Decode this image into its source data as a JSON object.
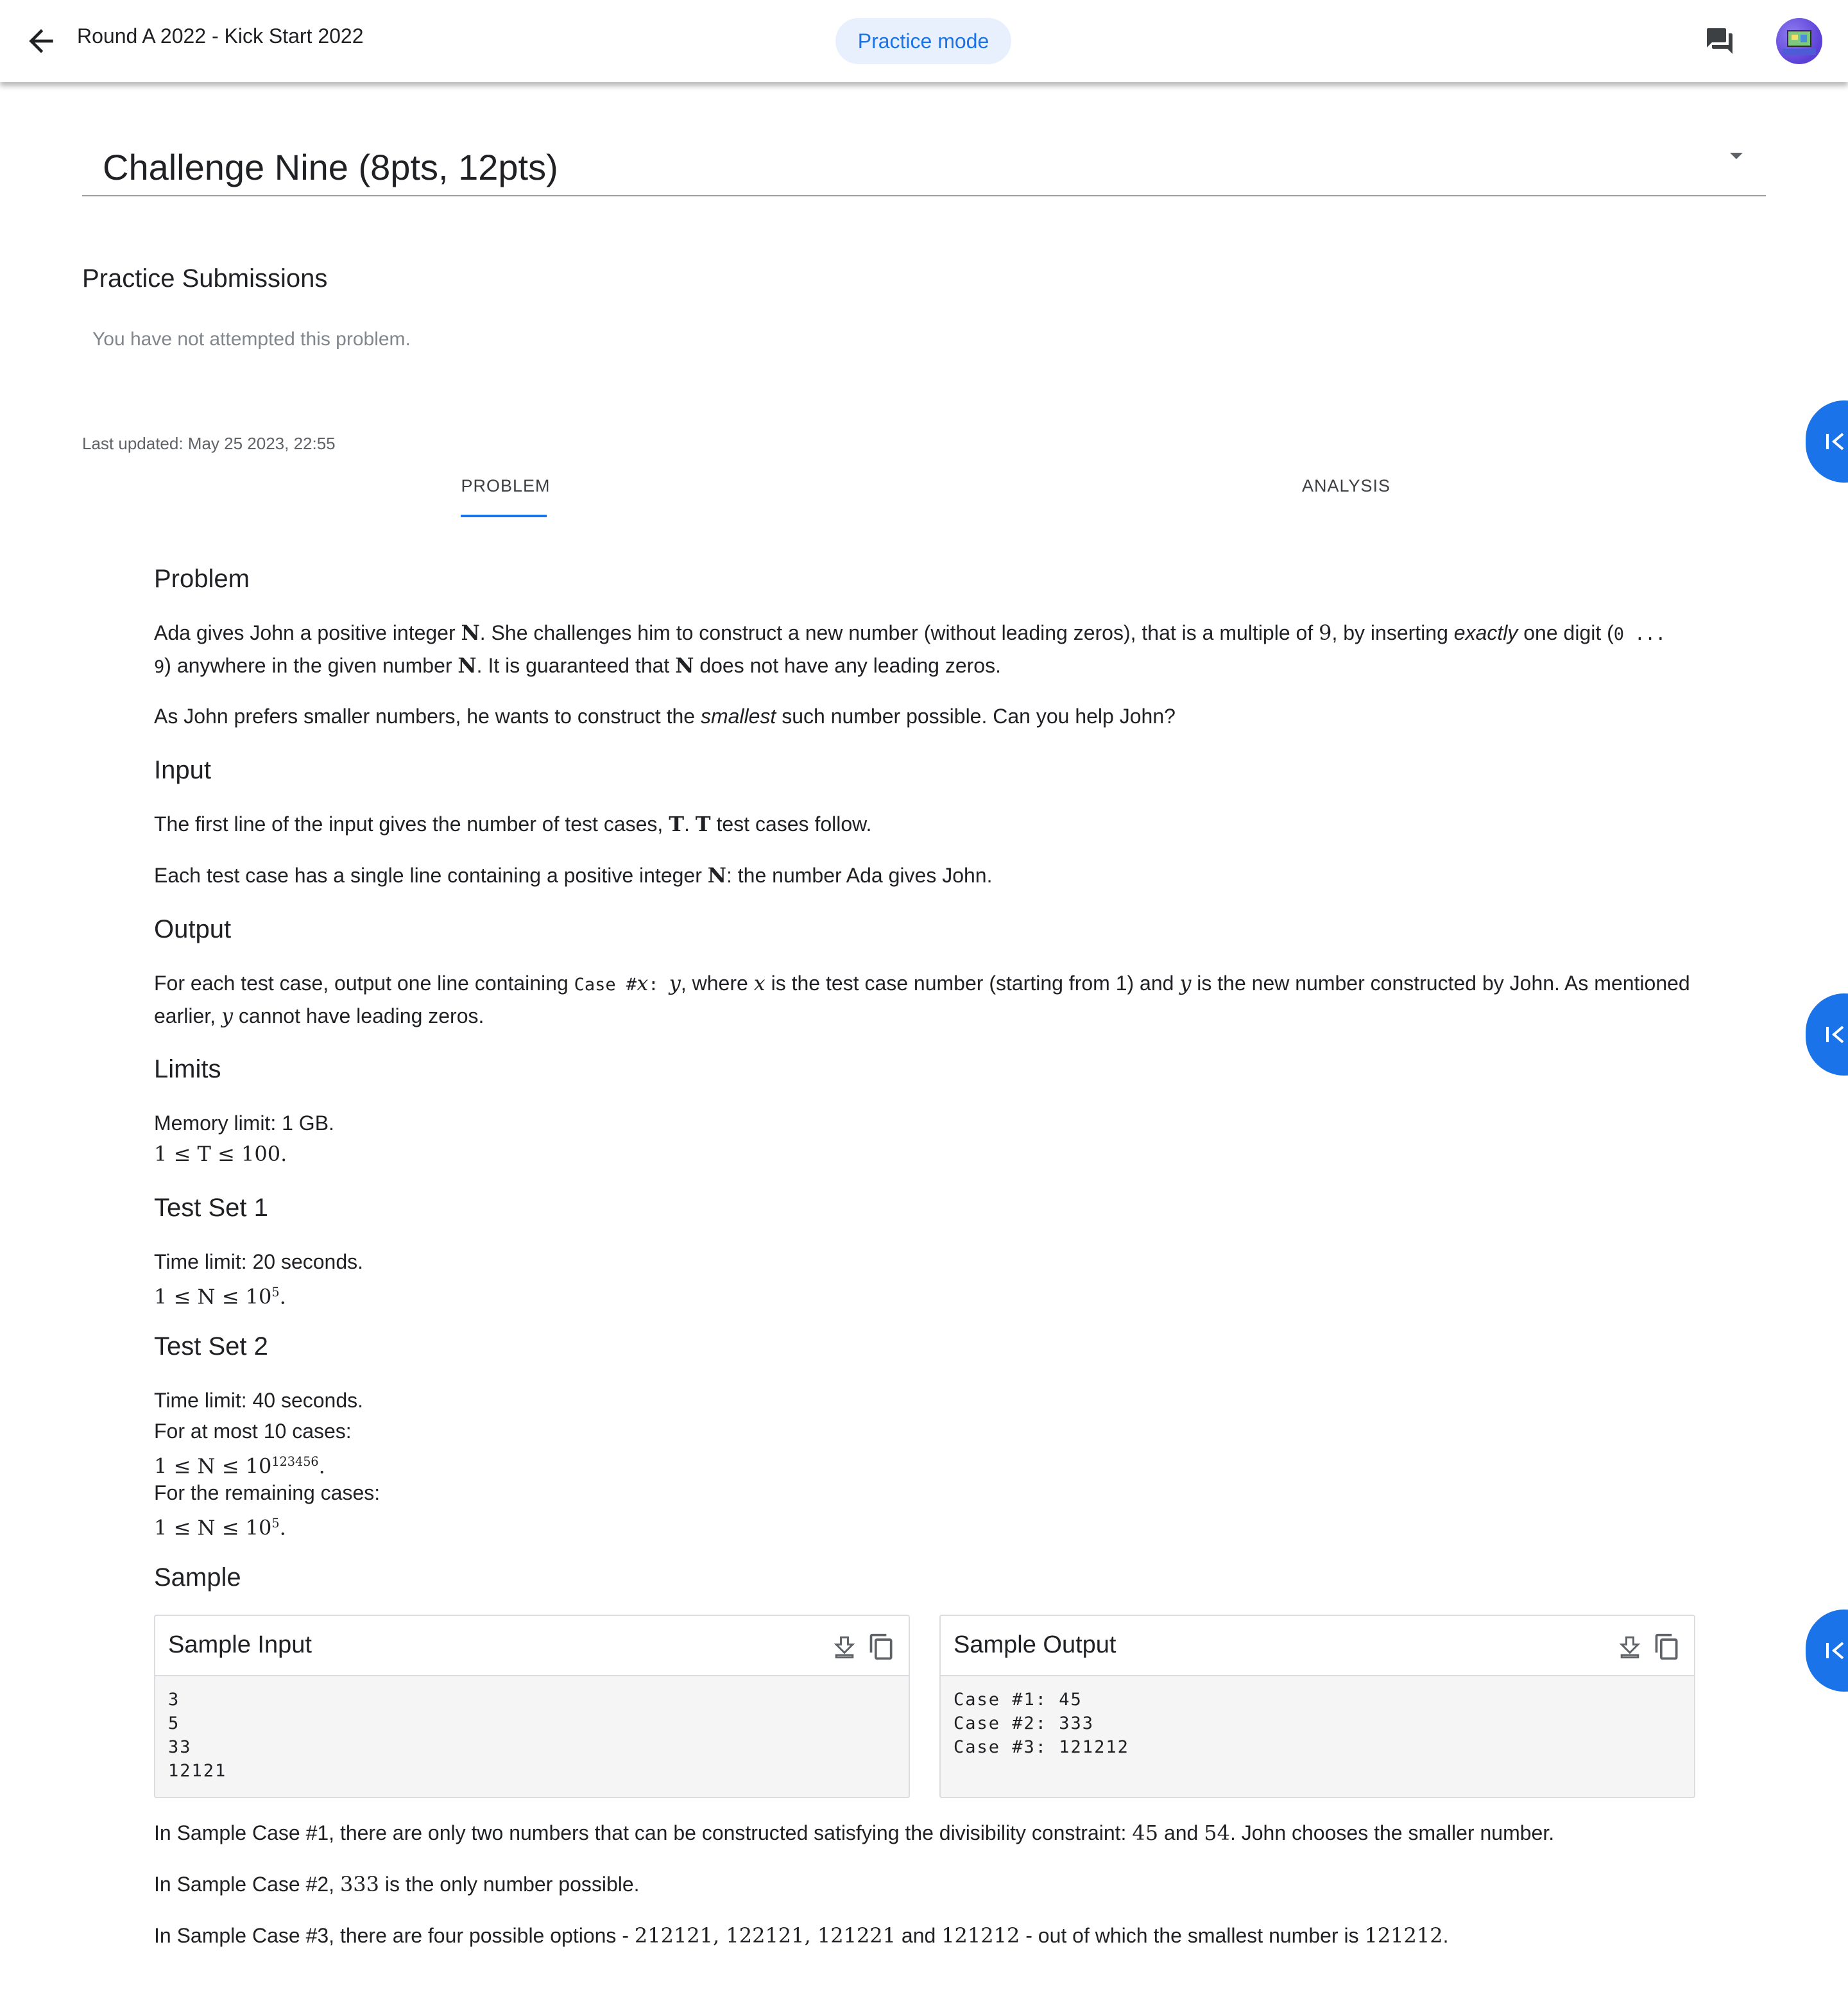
{
  "header": {
    "round_title": "Round A 2022 - Kick Start 2022",
    "mode_label": "Practice mode"
  },
  "problem_select": {
    "title": "Challenge Nine (8pts, 12pts)"
  },
  "submissions": {
    "title": "Practice Submissions",
    "empty_text": "You have not attempted this problem."
  },
  "last_updated": "Last updated: May 25 2023, 22:55",
  "tabs": [
    {
      "label": "PROBLEM"
    },
    {
      "label": "ANALYSIS"
    }
  ],
  "statement": {
    "problem_heading": "Problem",
    "p1_a": "Ada gives John a positive integer ",
    "p1_N": "N",
    "p1_b": ". She challenges him to construct a new number (without leading zeros), that is a multiple of ",
    "p1_9": "9",
    "p1_c": ", by inserting ",
    "p1_exactly": "exactly",
    "p1_d": " one digit (",
    "p1_range0": "0 ...",
    "p1_range9": "9",
    "p1_e": ") anywhere in the given number ",
    "p1_N2": "N",
    "p1_f": ". It is guaranteed that ",
    "p1_N3": "N",
    "p1_g": " does not have any leading zeros.",
    "p2_a": "As John prefers smaller numbers, he wants to construct the ",
    "p2_smallest": "smallest",
    "p2_b": " such number possible. Can you help John?",
    "input_heading": "Input",
    "in1_a": "The first line of the input gives the number of test cases, ",
    "in1_T": "T",
    "in1_b": ". ",
    "in1_T2": "T",
    "in1_c": " test cases follow.",
    "in2_a": "Each test case has a single line containing a positive integer ",
    "in2_N": "N",
    "in2_b": ": the number Ada gives John.",
    "output_heading": "Output",
    "out_a": "For each test case, output one line containing ",
    "out_case": "Case #",
    "out_x": "x",
    "out_colon": ": ",
    "out_y": "y",
    "out_b": ", where ",
    "out_x2": "x",
    "out_c": " is the test case number (starting from 1) and ",
    "out_y2": "y",
    "out_d": " is the new number constructed by John. As mentioned earlier, ",
    "out_y3": "y",
    "out_e": " cannot have leading zeros.",
    "limits_heading": "Limits",
    "mem_limit": "Memory limit: 1 GB.",
    "lim_T": "1 ≤ T ≤ 100.",
    "ts1_heading": "Test Set 1",
    "ts1_time": "Time limit: 20 seconds.",
    "ts1_bound_base": "1 ≤ N ≤ 10",
    "ts1_bound_exp": "5",
    "ts2_heading": "Test Set 2",
    "ts2_time": "Time limit: 40 seconds.",
    "ts2_atmost": "For at most 10 cases:",
    "ts2_bound1_base": "1 ≤ N ≤ 10",
    "ts2_bound1_exp": "123456",
    "ts2_remaining": "For the remaining cases:",
    "ts2_bound2_base": "1 ≤ N ≤ 10",
    "ts2_bound2_exp": "5",
    "sample_heading": "Sample"
  },
  "sample_input": {
    "label": "Sample Input",
    "content": "3\n5\n33\n12121"
  },
  "sample_output": {
    "label": "Sample Output",
    "content": "Case #1: 45\nCase #2: 333\nCase #3: 121212"
  },
  "explanations": {
    "e1_a": "In Sample Case #1, there are only two numbers that can be constructed satisfying the divisibility constraint: ",
    "e1_45": "45",
    "e1_and": " and ",
    "e1_54": "54",
    "e1_b": ". John chooses the smaller number.",
    "e2_a": "In Sample Case #2, ",
    "e2_333": "333",
    "e2_b": " is the only number possible.",
    "e3_a": "In Sample Case #3, there are four possible options - ",
    "e3_list": "212121, 122121, 121221",
    "e3_and": " and ",
    "e3_121212": "121212",
    "e3_b": " - out of which the smallest number is ",
    "e3_ans": "121212",
    "e3_c": "."
  },
  "colors": {
    "accent": "#1a73e8",
    "pill_bg": "#e8f0fe",
    "text": "#202124",
    "muted": "#80868b"
  },
  "icons": [
    "back-arrow-icon",
    "chat-icon",
    "dropdown-caret-icon",
    "collapse-left-icon",
    "download-icon",
    "copy-icon"
  ]
}
